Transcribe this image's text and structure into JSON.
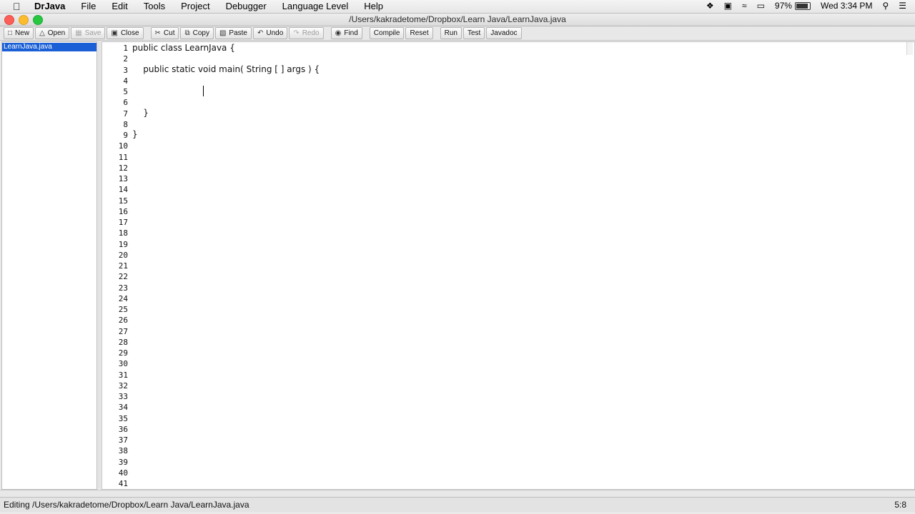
{
  "menubar": {
    "app_name": "DrJava",
    "menus": [
      "File",
      "Edit",
      "Tools",
      "Project",
      "Debugger",
      "Language Level",
      "Help"
    ],
    "battery": "97%",
    "clock": "Wed 3:34 PM",
    "icons": [
      "apple-icon",
      "dropbox-icon",
      "facetime-icon",
      "wifi-icon",
      "airplay-icon",
      "battery-icon",
      "spotlight-icon",
      "notification-center-icon"
    ]
  },
  "window": {
    "title": "/Users/kakradetome/Dropbox/Learn Java/LearnJava.java"
  },
  "toolbar": {
    "new": "New",
    "open": "Open",
    "save": "Save",
    "close": "Close",
    "cut": "Cut",
    "copy": "Copy",
    "paste": "Paste",
    "undo": "Undo",
    "redo": "Redo",
    "find": "Find",
    "compile": "Compile",
    "reset": "Reset",
    "run": "Run",
    "test": "Test",
    "javadoc": "Javadoc"
  },
  "files": {
    "items": [
      "LearnJava.java"
    ]
  },
  "editor": {
    "line_count": 41,
    "lines": [
      "public class LearnJava {",
      "",
      "    public static void main( String [ ] args ) {",
      "",
      "",
      "",
      "    }",
      "",
      "}"
    ]
  },
  "status": {
    "text": "Editing /Users/kakradetome/Dropbox/Learn Java/LearnJava.java",
    "position": "5:8"
  },
  "colors": {
    "selection": "#1a5fd6",
    "close_light": "#fc5f57",
    "minimize_light": "#fdbc2e",
    "zoom_light": "#27c840"
  }
}
